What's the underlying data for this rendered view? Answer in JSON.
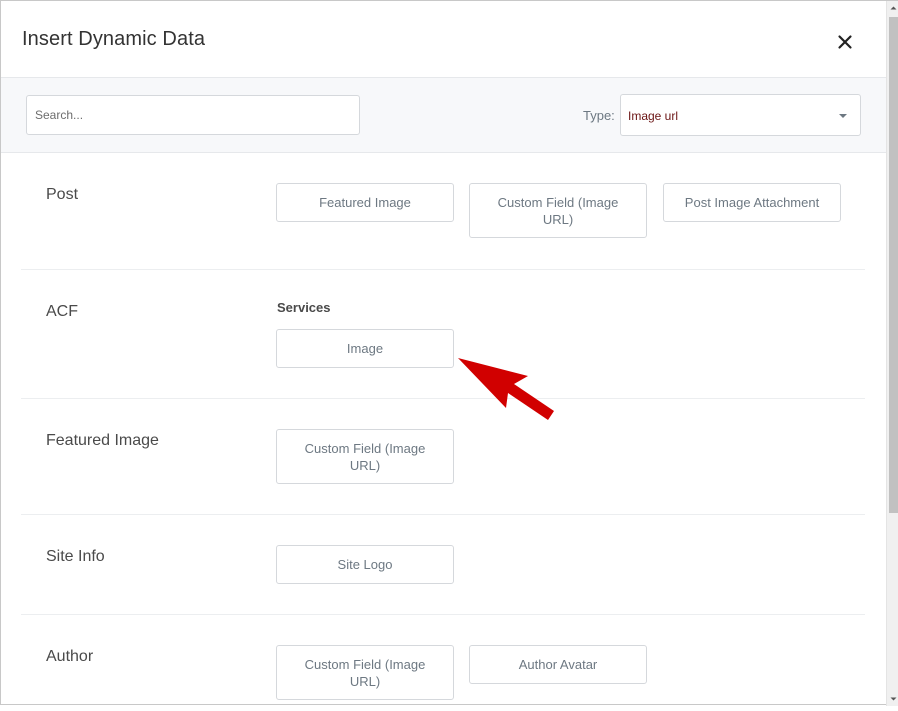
{
  "dialog": {
    "title": "Insert Dynamic Data",
    "close_icon": "close-icon"
  },
  "filter": {
    "search_placeholder": "Search...",
    "search_value": "",
    "type_label": "Type:",
    "type_value": "Image url",
    "type_caret_icon": "caret-down-icon"
  },
  "sections": {
    "post": {
      "title": "Post",
      "options": [
        "Featured Image",
        "Custom Field (Image URL)",
        "Post Image Attachment"
      ]
    },
    "acf": {
      "title": "ACF",
      "group_title": "Services",
      "options": [
        "Image"
      ]
    },
    "featured_image": {
      "title": "Featured Image",
      "options": [
        "Custom Field (Image URL)"
      ]
    },
    "site_info": {
      "title": "Site Info",
      "options": [
        "Site Logo"
      ]
    },
    "author": {
      "title": "Author",
      "options": [
        "Custom Field (Image URL)",
        "Author Avatar"
      ]
    }
  },
  "annotation": {
    "arrow_color": "#d10000",
    "arrow_icon": "red-arrow-pointer"
  }
}
